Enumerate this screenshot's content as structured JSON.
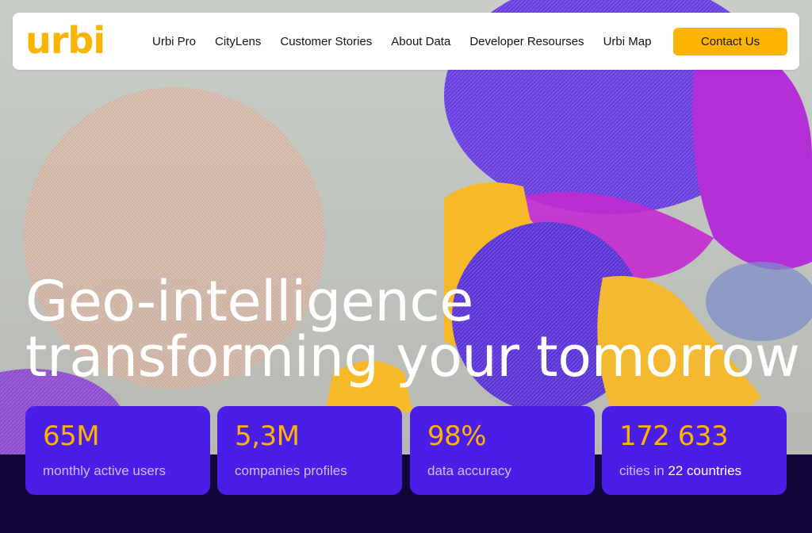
{
  "brand": {
    "logo_text": "urbi",
    "accent_color": "#fdb400",
    "primary_color": "#4a1ee6",
    "dark_color": "#12053a"
  },
  "nav": {
    "items": [
      {
        "label": "Urbi Pro"
      },
      {
        "label": "CityLens"
      },
      {
        "label": "Customer Stories"
      },
      {
        "label": "About Data"
      },
      {
        "label": "Developer Resourses"
      },
      {
        "label": "Urbi Map"
      }
    ],
    "cta_label": "Contact Us"
  },
  "hero": {
    "headline_line1": "Geo-intelligence",
    "headline_line2": "transforming your tomorrow"
  },
  "stats": [
    {
      "value": "65M",
      "label": "monthly active users"
    },
    {
      "value": "5,3M",
      "label": "companies profiles"
    },
    {
      "value": "98%",
      "label": "data accuracy"
    },
    {
      "value": "172 633",
      "label_prefix": "cities in ",
      "label_highlight": "22 countries"
    }
  ]
}
